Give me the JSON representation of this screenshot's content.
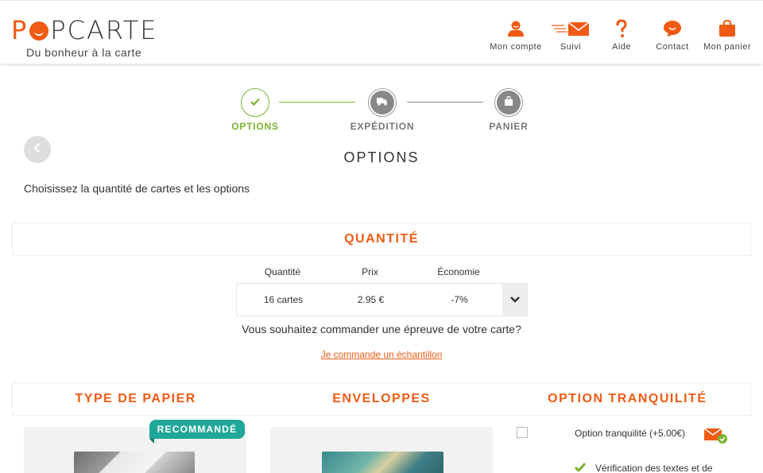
{
  "header": {
    "logo": {
      "p1": "P",
      "rest": "PCARTE"
    },
    "tagline": "Du bonheur à la carte",
    "nav": [
      {
        "label": "Mon compte",
        "icon": "user-icon"
      },
      {
        "label": "Suivi",
        "icon": "tracking-envelope-icon"
      },
      {
        "label": "Aide",
        "icon": "question-mark-icon"
      },
      {
        "label": "Contact",
        "icon": "chat-bubble-icon"
      },
      {
        "label": "Mon panier",
        "icon": "shopping-bag-icon"
      }
    ]
  },
  "stepper": {
    "steps": [
      {
        "label": "OPTIONS",
        "state": "active",
        "icon": "check-icon"
      },
      {
        "label": "EXPÉDITION",
        "state": "pending",
        "icon": "truck-icon"
      },
      {
        "label": "PANIER",
        "state": "pending",
        "icon": "bag-icon"
      }
    ]
  },
  "page": {
    "title": "OPTIONS",
    "intro": "Choisissez la quantité de cartes et les options"
  },
  "quantity": {
    "section_title": "QUANTITÉ",
    "headers": {
      "qty": "Quantité",
      "price": "Prix",
      "saving": "Économie"
    },
    "selected": {
      "qty": "16 cartes",
      "price": "2.95 €",
      "saving": "-7%"
    },
    "proof_question": "Vous souhaitez commander une épreuve de votre carte?",
    "proof_link": "Je commande un échantillon"
  },
  "columns": {
    "paper_title": "TYPE DE PAPIER",
    "envelopes_title": "ENVELOPPES",
    "option_title": "OPTION TRANQUILITÉ",
    "badge": "RECOMMANDÉ",
    "option_label": "Option tranquilité (+5.00€)",
    "benefit_1": "Vérification des textes et de"
  },
  "colors": {
    "accent": "#f05a14",
    "success": "#7ab330",
    "badge": "#1fa89a"
  }
}
